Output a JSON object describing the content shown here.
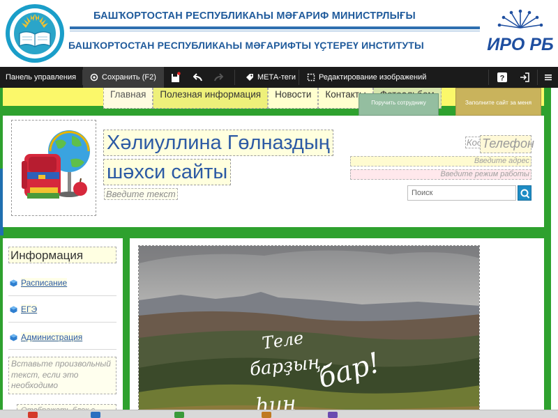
{
  "header": {
    "line1": "БАШҠОРТОСТАН РЕСПУБЛИКАҺЫ МӘҒАРИФ МИНИСТРЛЫҒЫ",
    "line2": "БАШҠОРТОСТАН РЕСПУБЛИКАҺЫ МӘҒАРИФТЫ ҮҪТЕРЕҮ ИНСТИТУТЫ",
    "logo_right_text": "ИРО РБ"
  },
  "toolbar": {
    "panel_label": "Панель управления",
    "save_label": "Сохранить (F2)",
    "meta_label": "МЕТА-теги",
    "edit_images_label": "Редактирование изображений"
  },
  "nav": {
    "items": [
      "Главная",
      "Полезная информация",
      "Новости",
      "Контакты",
      "Фотоальбом"
    ],
    "employee_button": "Поручить сотруднику",
    "fill_button": "Заполните сайт за меня"
  },
  "site": {
    "title_line1": "Хәлиуллина Гөлназдың",
    "title_line2": "шәхси сайты",
    "subtitle_placeholder": "Введите текст",
    "code_label": "Код",
    "phone_label": "Телефон",
    "address_placeholder": "Введите адрес",
    "mode_placeholder": "Введите режим работы",
    "search_placeholder": "Поиск"
  },
  "sidebar": {
    "title": "Информация",
    "items": [
      "Расписание",
      "ЕГЭ",
      "Администрация"
    ],
    "note": "Вставьте произвольный текст, если это необходимо",
    "note2": "Отображать блок с"
  },
  "photo": {
    "line1": "Теле",
    "line2": "барҙың,",
    "line3": "бар!",
    "line4": "һин"
  },
  "colors": {
    "site_green": "#2ea12e",
    "topbar_yellow": "#fbf86a",
    "title_blue": "#2c5aa4",
    "toolbar_bg": "#1b1b1b",
    "header_blue": "#1f5a9b"
  }
}
